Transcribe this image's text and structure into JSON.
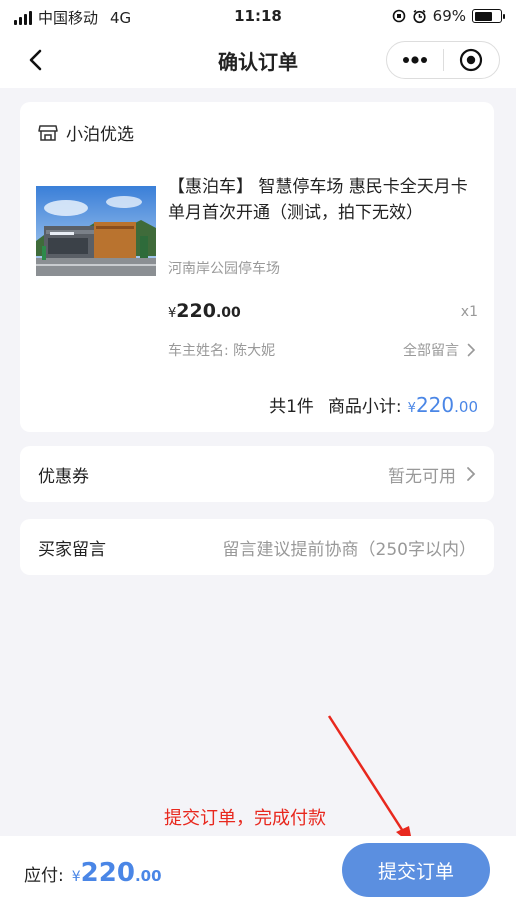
{
  "status_bar": {
    "carrier": "中国移动",
    "network": "4G",
    "time": "11:18",
    "battery": "69%",
    "battery_level": 0.69
  },
  "nav": {
    "title": "确认订单"
  },
  "order": {
    "shop_name": "小泊优选",
    "product_title": "【惠泊车】 智慧停车场 惠民卡全天月卡 单月首次开通（测试，拍下无效）",
    "product_shop": "河南岸公园停车场",
    "price_symbol": "¥",
    "price_int": "220",
    "price_dec": ".00",
    "quantity": "x1",
    "owner": "车主姓名: 陈大妮",
    "all_messages": "全部留言",
    "count_text": "共1件",
    "subtotal_label": "商品小计:",
    "subtotal_symbol": "¥",
    "subtotal_int": "220",
    "subtotal_dec": ".00"
  },
  "coupon": {
    "label": "优惠券",
    "value": "暂无可用"
  },
  "buyer_message": {
    "label": "买家留言",
    "placeholder": "留言建议提前协商（250字以内）"
  },
  "annotation": {
    "text": "提交订单，完成付款",
    "color": "#e8281e"
  },
  "footer": {
    "pay_label": "应付:",
    "pay_symbol": "¥",
    "pay_int": "220",
    "pay_dec": ".00",
    "submit_label": "提交订单"
  },
  "colors": {
    "accent": "#4a86e6",
    "button": "#5b8fe0"
  }
}
